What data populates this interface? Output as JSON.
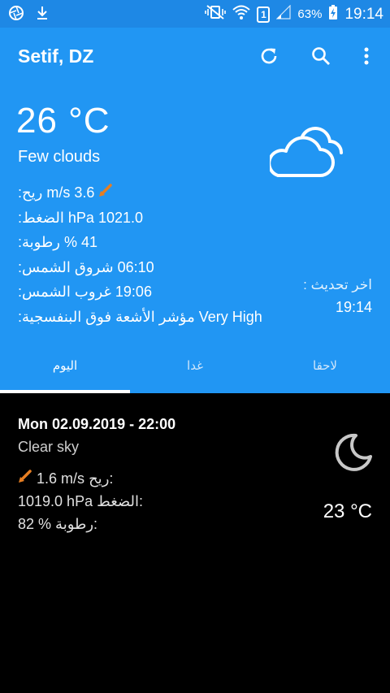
{
  "status_bar": {
    "battery_percent": "63%",
    "sim_slot": "1",
    "time": "19:14"
  },
  "app_bar": {
    "title": "Setif, DZ",
    "icons": [
      "refresh-icon",
      "search-icon",
      "overflow-menu-icon"
    ]
  },
  "current": {
    "temperature": "26 °C",
    "condition": "Few clouds",
    "icon": "cloud-icon",
    "wind_label": "ريح:",
    "wind_value": "3.6 m/s",
    "pressure_label": "الضغط:",
    "pressure_value": "1021.0 hPa",
    "humidity_label": "رطوبة:",
    "humidity_value": "41 %",
    "sunrise_label": "شروق الشمس:",
    "sunrise_value": "06:10",
    "sunset_label": "غروب الشمس:",
    "sunset_value": "19:06",
    "uv_label": "مؤشر الأشعة فوق البنفسجية:",
    "uv_value": "Very High",
    "last_update_label": "اخر تحديث :",
    "last_update_time": "19:14"
  },
  "tabs": [
    {
      "label": "اليوم",
      "active": true
    },
    {
      "label": "غدا",
      "active": false
    },
    {
      "label": "لاحقا",
      "active": false
    }
  ],
  "forecast": {
    "date": "Mon 02.09.2019 - 22:00",
    "condition": "Clear sky",
    "icon": "moon-icon",
    "wind_label": "ريح:",
    "wind_value": "1.6 m/s",
    "pressure_label": "الضغط:",
    "pressure_value": "1019.0 hPa",
    "humidity_label": "رطوبة:",
    "humidity_value": "82 %",
    "temperature": "23 °C"
  },
  "colors": {
    "primary": "#2196f3",
    "status_bar": "#1e88e5",
    "wind_arrow": "#e67e22"
  }
}
